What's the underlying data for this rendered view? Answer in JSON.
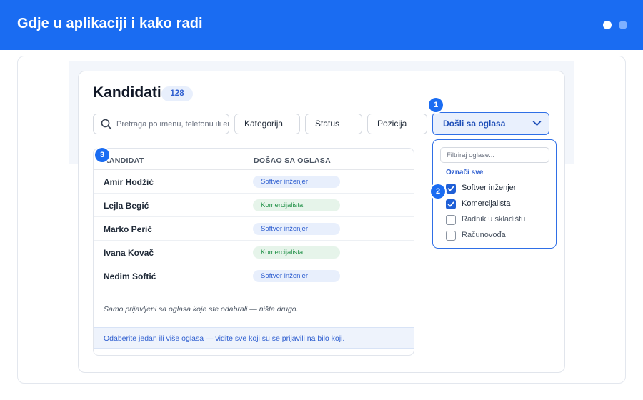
{
  "header": {
    "title": "Gdje u aplikaciji i kako radi",
    "colors": {
      "bar": "#1a6cf2",
      "accent": "#2f6fe6"
    }
  },
  "page": {
    "title": "Kandidati",
    "count": "128"
  },
  "search": {
    "placeholder": "Pretraga po imenu, telefonu ili email"
  },
  "filters": {
    "kategorija": "Kategorija",
    "status": "Status",
    "pozicija": "Pozicija",
    "dosli_sa_oglasa": "Došli sa oglasa"
  },
  "markers": [
    "1",
    "2",
    "3"
  ],
  "table": {
    "columns": [
      "KANDIDAT",
      "DOŠAO SA OGLASA"
    ],
    "rows": [
      {
        "name": "Amir Hodžić",
        "ad": "Softver inženjer",
        "tone": "blue"
      },
      {
        "name": "Lejla Begić",
        "ad": "Komercijalista",
        "tone": "green"
      },
      {
        "name": "Marko Perić",
        "ad": "Softver inženjer",
        "tone": "blue"
      },
      {
        "name": "Ivana Kovač",
        "ad": "Komercijalista",
        "tone": "green"
      },
      {
        "name": "Nedim Softić",
        "ad": "Softver inženjer",
        "tone": "blue"
      }
    ],
    "note": "Samo prijavljeni sa oglasa koje ste odabrali — ništa drugo.",
    "info": "Odaberite jedan ili više oglasa — vidite sve koji su se prijavili na bilo koji."
  },
  "dropdown": {
    "filter_placeholder": "Filtriraj oglase...",
    "select_all": "Označi sve",
    "options": [
      {
        "label": "Softver inženjer",
        "checked": true
      },
      {
        "label": "Komercijalista",
        "checked": true
      },
      {
        "label": "Radnik u skladištu",
        "checked": false
      },
      {
        "label": "Računovođa",
        "checked": false
      }
    ]
  },
  "icons": {
    "search": "search-icon",
    "chevron": "chevron-down-icon",
    "check": "check-icon"
  }
}
